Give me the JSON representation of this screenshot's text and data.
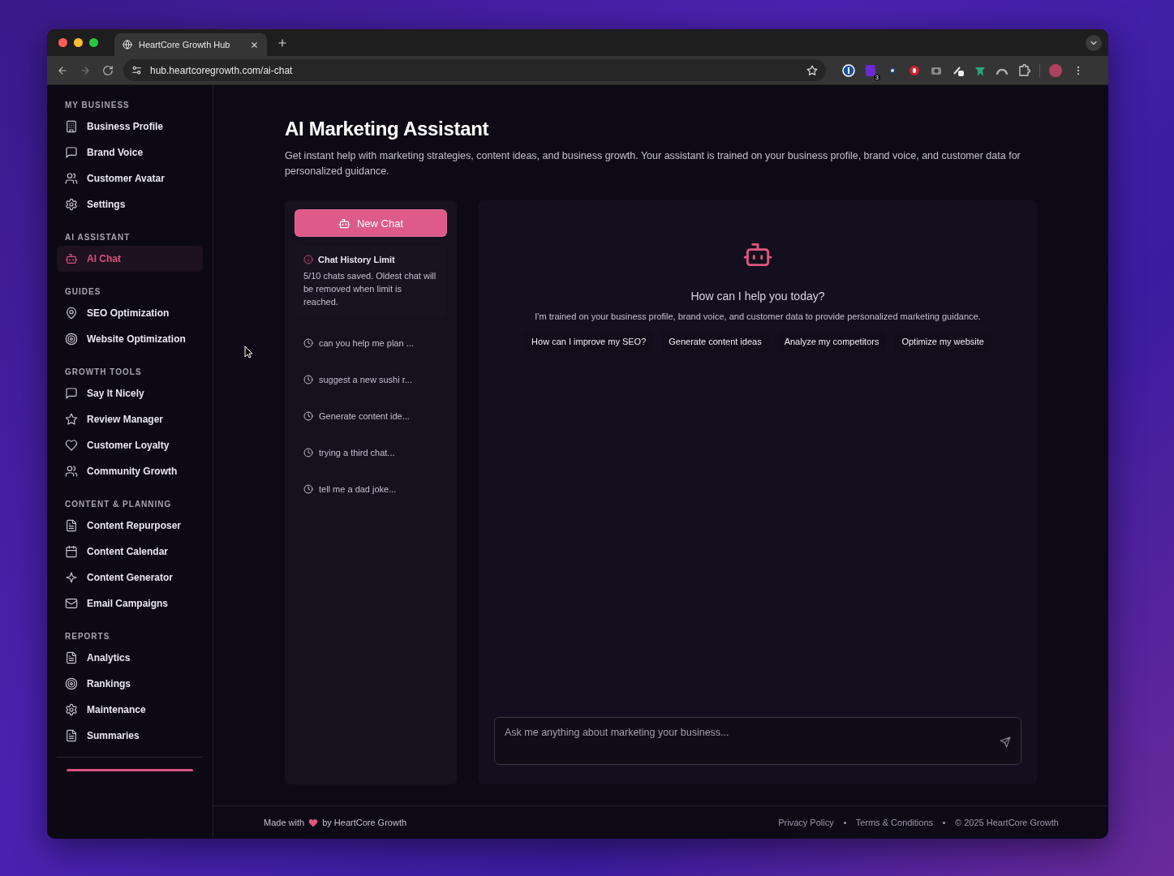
{
  "browser": {
    "tab": {
      "title": "HeartCore Growth Hub",
      "selected": true
    },
    "url": "hub.heartcoregrowth.com/ai-chat",
    "extensions": [
      {
        "kind": "lock"
      },
      {
        "kind": "letter",
        "badge": "3"
      },
      {
        "kind": "dot"
      },
      {
        "kind": "hand"
      },
      {
        "kind": "camera"
      },
      {
        "kind": "tool"
      },
      {
        "kind": "bird"
      },
      {
        "kind": "arch"
      },
      {
        "kind": "puzzle"
      }
    ]
  },
  "sidebar": {
    "sections": [
      {
        "title": "MY BUSINESS",
        "items": [
          {
            "label": "Business Profile",
            "kind": "building",
            "selected": false
          },
          {
            "label": "Brand Voice",
            "kind": "message",
            "selected": false
          },
          {
            "label": "Customer Avatar",
            "kind": "users",
            "selected": false
          },
          {
            "label": "Settings",
            "kind": "gear",
            "selected": false
          }
        ]
      },
      {
        "title": "AI ASSISTANT",
        "items": [
          {
            "label": "AI Chat",
            "kind": "bot",
            "selected": true
          }
        ]
      },
      {
        "title": "GUIDES",
        "items": [
          {
            "label": "SEO Optimization",
            "kind": "pin",
            "selected": false
          },
          {
            "label": "Website Optimization",
            "kind": "target",
            "selected": false
          }
        ]
      },
      {
        "title": "GROWTH TOOLS",
        "items": [
          {
            "label": "Say It Nicely",
            "kind": "message",
            "selected": false
          },
          {
            "label": "Review Manager",
            "kind": "star",
            "selected": false
          },
          {
            "label": "Customer Loyalty",
            "kind": "heart",
            "selected": false
          },
          {
            "label": "Community Growth",
            "kind": "users",
            "selected": false
          }
        ]
      },
      {
        "title": "CONTENT & PLANNING",
        "items": [
          {
            "label": "Content Repurposer",
            "kind": "file",
            "selected": false
          },
          {
            "label": "Content Calendar",
            "kind": "calendar",
            "selected": false
          },
          {
            "label": "Content Generator",
            "kind": "sparkles",
            "selected": false
          },
          {
            "label": "Email Campaigns",
            "kind": "mail",
            "selected": false
          }
        ]
      },
      {
        "title": "REPORTS",
        "items": [
          {
            "label": "Analytics",
            "kind": "file",
            "selected": false
          },
          {
            "label": "Rankings",
            "kind": "target",
            "selected": false
          },
          {
            "label": "Maintenance",
            "kind": "gear",
            "selected": false
          },
          {
            "label": "Summaries",
            "kind": "file",
            "selected": false
          }
        ]
      }
    ]
  },
  "page": {
    "title": "AI Marketing Assistant",
    "subtitle": "Get instant help with marketing strategies, content ideas, and business growth. Your assistant is trained on your business profile, brand voice, and customer data for personalized guidance."
  },
  "history": {
    "new_chat": "New Chat",
    "limit": {
      "title": "Chat History Limit",
      "text": "5/10 chats saved. Oldest chat will be removed when limit is reached."
    },
    "chats": [
      {
        "title": "can you help me plan ..."
      },
      {
        "title": "suggest a new sushi r..."
      },
      {
        "title": "Generate content ide..."
      },
      {
        "title": "trying a third chat..."
      },
      {
        "title": "tell me a dad joke..."
      }
    ]
  },
  "chat": {
    "heading": "How can I help you today?",
    "text": "I'm trained on your business profile, brand voice, and customer data to provide personalized marketing guidance.",
    "suggestions": [
      "How can I improve my SEO?",
      "Generate content ideas",
      "Analyze my competitors",
      "Optimize my website"
    ],
    "input": {
      "placeholder": "Ask me anything about marketing your business..."
    }
  },
  "footer": {
    "made_with": "Made with",
    "by": "by HeartCore Growth",
    "links": [
      "Privacy Policy",
      "Terms & Conditions"
    ],
    "copyright": "© 2025 HeartCore Growth"
  }
}
